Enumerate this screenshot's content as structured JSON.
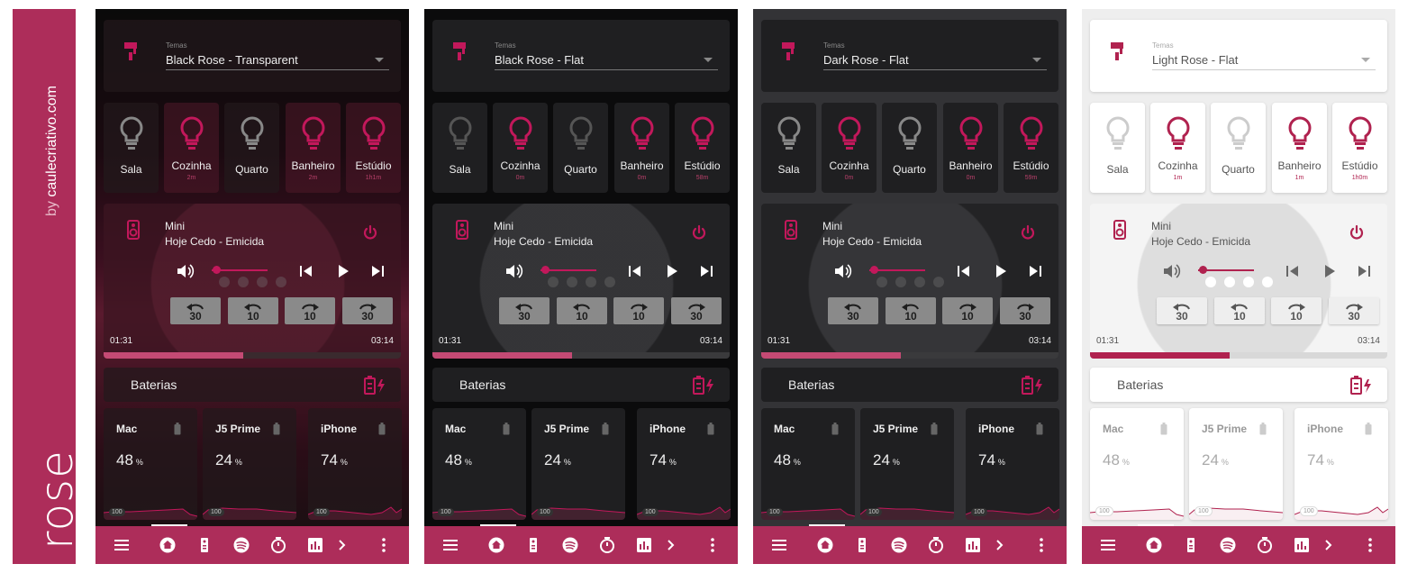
{
  "brand": {
    "by": "by ",
    "site": "caulecriativo.com",
    "word": "rose"
  },
  "common": {
    "theme_label": "Temas",
    "lights": [
      "Sala",
      "Cozinha",
      "Quarto",
      "Banheiro",
      "Estúdio"
    ],
    "player_name": "Mini",
    "track": "Hoje Cedo - Emicida",
    "time_current": "01:31",
    "time_total": "03:14",
    "progress": 0.47,
    "volume": 0.05,
    "skip_buttons": [
      "30",
      "10",
      "10",
      "30"
    ],
    "batteries_title": "Baterias",
    "devices": [
      "Mac",
      "J5 Prime",
      "iPhone"
    ],
    "battery_values": [
      "48",
      "24",
      "74"
    ],
    "battery_unit": "%",
    "battery_tag": "100",
    "nav_icons": [
      "menu-icon",
      "home-icon",
      "remote-icon",
      "spotify-icon",
      "timer-icon",
      "chart-icon",
      "chevron-right-icon",
      "more-icon"
    ]
  },
  "panels": [
    {
      "theme": "Black Rose - Transparent",
      "times": [
        "",
        "2m",
        "",
        "2m",
        "1h1m"
      ],
      "colors": {
        "accent": "#c2185b"
      }
    },
    {
      "theme": "Black Rose - Flat",
      "times": [
        "",
        "0m",
        "",
        "0m",
        "58m"
      ],
      "colors": {
        "accent": "#c2185b"
      }
    },
    {
      "theme": "Dark Rose - Flat",
      "times": [
        "",
        "0m",
        "",
        "0m",
        "59m"
      ],
      "colors": {
        "accent": "#c2185b"
      }
    },
    {
      "theme": "Light Rose - Flat",
      "times": [
        "",
        "1m",
        "",
        "1m",
        "1h0m"
      ],
      "colors": {
        "accent": "#b0224f"
      }
    }
  ]
}
